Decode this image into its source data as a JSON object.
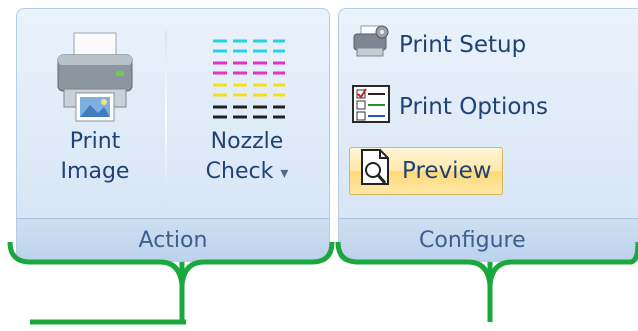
{
  "groups": {
    "action": {
      "title": "Action",
      "buttons": [
        {
          "label_line1": "Print",
          "label_line2": "Image",
          "icon": "printer-icon"
        },
        {
          "label_line1": "Nozzle",
          "label_line2": "Check",
          "icon": "nozzle-pattern-icon",
          "has_dropdown": true
        }
      ]
    },
    "configure": {
      "title": "Configure",
      "buttons": [
        {
          "label": "Print Setup",
          "icon": "printer-setup-icon"
        },
        {
          "label": "Print Options",
          "icon": "print-options-icon"
        },
        {
          "label": "Preview",
          "icon": "preview-icon",
          "state": "highlighted"
        }
      ]
    }
  },
  "dropdown_glyph": "▾",
  "colors": {
    "ribbon_text": "#1f4376",
    "group_title": "#3b5f8f",
    "highlight_border": "#d9b65a",
    "annotation_green": "#1aa83c"
  }
}
